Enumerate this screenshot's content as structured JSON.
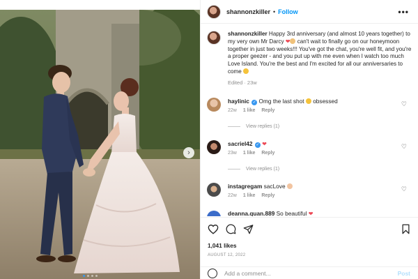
{
  "post": {
    "username": "shannonzkiller",
    "separator": "•",
    "follow_label": "Follow",
    "more_label": "•••",
    "accent": "#0095f6",
    "image_alt": "Bride and groom holding hands in front of stone ruins",
    "carousel_dots": 4,
    "carousel_active": 0
  },
  "caption": {
    "username": "shannonzkiller",
    "text_1": "Happy 3rd anniversary (and almost 10 years together) to my very own Mr Darcy",
    "text_2": "can't wait to finally go on our honeymoon together in just two weeks!!! You've got the chat, you're well fit, and you're a proper geezer - and you put up with me even when I watch too much Love Island. You're the best and I'm excited for all our anniversaries to come",
    "meta": "Edited · 23w"
  },
  "comments": [
    {
      "username": "haylinic",
      "verified": true,
      "text": "Omg the last shot",
      "text_after": "obsessed",
      "time": "22w",
      "likes": "1 like",
      "reply": "Reply",
      "view_replies": "View replies (1)"
    },
    {
      "username": "sacriel42",
      "verified": true,
      "text": "",
      "text_after": "",
      "time": "23w",
      "likes": "1 like",
      "reply": "Reply",
      "view_replies": "View replies (1)"
    },
    {
      "username": "instagregam",
      "verified": false,
      "text": "sacLove",
      "text_after": "",
      "time": "22w",
      "likes": "1 like",
      "reply": "Reply",
      "view_replies": ""
    },
    {
      "username": "deanna.quan.889",
      "verified": false,
      "text": "So beautiful",
      "text_after": "",
      "time": "",
      "likes": "",
      "reply": "",
      "view_replies": ""
    }
  ],
  "actions": {
    "likes": "1,041 likes",
    "date": "AUGUST 12, 2022",
    "comment_placeholder": "Add a comment...",
    "post_label": "Post",
    "post_color": "#b2dffc"
  }
}
